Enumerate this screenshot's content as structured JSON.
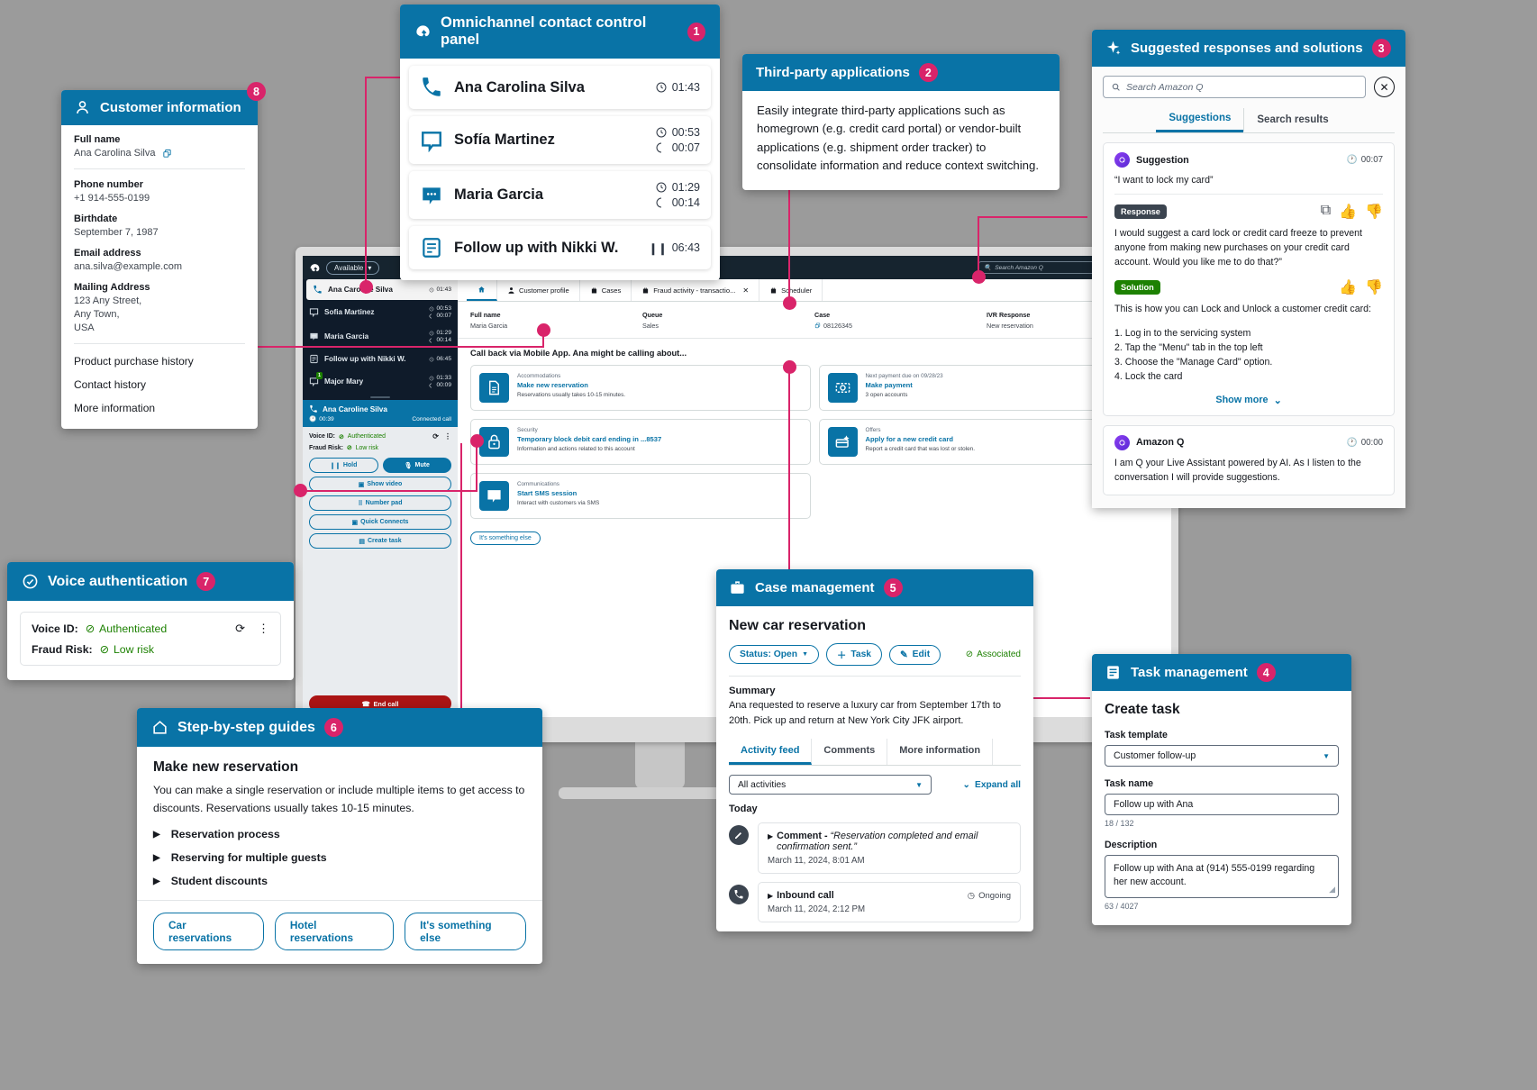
{
  "omnichannel": {
    "title": "Omnichannel contact control panel",
    "num": "1",
    "contacts": [
      {
        "name": "Ana Carolina Silva",
        "icon": "phone-icon",
        "t1": "01:43",
        "t2": ""
      },
      {
        "name": "Sofía Martinez",
        "icon": "chat-icon",
        "t1": "00:53",
        "t2": "00:07"
      },
      {
        "name": "Maria Garcia",
        "icon": "sms-icon",
        "t1": "01:29",
        "t2": "00:14"
      },
      {
        "name": "Follow up with Nikki W.",
        "icon": "task-icon",
        "t1": "06:43",
        "t2": ""
      }
    ]
  },
  "thirdparty": {
    "title": "Third-party applications",
    "num": "2",
    "body": "Easily integrate third-party applications such as homegrown (e.g. credit card portal) or vendor-built applications (e.g. shipment order tracker) to consolidate information and reduce context switching."
  },
  "suggestions": {
    "title": "Suggested responses and solutions",
    "num": "3",
    "search_placeholder": "Search Amazon Q",
    "tabs": [
      "Suggestions",
      "Search results"
    ],
    "active_tab": "Suggestions",
    "card": {
      "label": "Suggestion",
      "time": "00:07",
      "quote": "“I want to lock my card”",
      "response_chip": "Response",
      "response_text": "I would suggest a card lock or credit card freeze to prevent anyone from making new purchases on your credit card account. Would you like me to do that?”",
      "solution_chip": "Solution",
      "solution_text": "This is how you can Lock and Unlock a customer credit card:",
      "steps": [
        "1. Log in to the servicing system",
        "2. Tap the \"Menu\" tab in the top left",
        "3. Choose the \"Manage Card\" option.",
        "4. Lock the card"
      ],
      "show_more": "Show more"
    },
    "amazonq": {
      "label": "Amazon Q",
      "time": "00:00",
      "text": "I am Q your Live Assistant powered by AI. As I listen to the conversation I will provide suggestions."
    }
  },
  "task": {
    "title": "Task management",
    "num": "4",
    "heading": "Create task",
    "template_label": "Task template",
    "template_value": "Customer follow-up",
    "name_label": "Task name",
    "name_value": "Follow up with Ana",
    "name_count": "18 / 132",
    "desc_label": "Description",
    "desc_value": "Follow up with Ana at (914) 555-0199 regarding her new account.",
    "desc_count": "63 / 4027"
  },
  "case": {
    "title": "Case management",
    "num": "5",
    "heading": "New car reservation",
    "status_button": "Status: Open",
    "task_button": "Task",
    "edit_button": "Edit",
    "associated": "Associated",
    "summary_label": "Summary",
    "summary": "Ana requested to reserve a luxury car from September 17th to 20th. Pick up and return at New York City JFK airport.",
    "tabs": [
      "Activity feed",
      "Comments",
      "More information"
    ],
    "active_tab": "Activity feed",
    "filter": "All activities",
    "expand": "Expand all",
    "today": "Today",
    "activities": [
      {
        "icon": "pencil-icon",
        "title_bold": "Comment - ",
        "title_italic": "“Reservation completed and email confirmation sent.”",
        "date": "March 11, 2024, 8:01 AM",
        "status": ""
      },
      {
        "icon": "phone-icon",
        "title_bold": "Inbound call",
        "title_italic": "",
        "date": "March 11, 2024, 2:12 PM",
        "status": "Ongoing"
      }
    ]
  },
  "guides": {
    "title": "Step-by-step guides",
    "num": "6",
    "heading": "Make new reservation",
    "body": "You can make a single reservation or include multiple items to get access to discounts. Reservations usually takes 10-15 minutes.",
    "items": [
      "Reservation process",
      "Reserving for multiple guests",
      "Student discounts"
    ],
    "pills": [
      "Car reservations",
      "Hotel reservations",
      "It's something else"
    ]
  },
  "voice": {
    "title": "Voice authentication",
    "num": "7",
    "rows": [
      {
        "k": "Voice ID:",
        "v": "Authenticated"
      },
      {
        "k": "Fraud Risk:",
        "v": "Low risk"
      }
    ]
  },
  "customer": {
    "title": "Customer information",
    "num": "8",
    "fields": [
      {
        "k": "Full name",
        "v": "Ana Carolina Silva",
        "copy": true
      },
      {
        "k": "Phone number",
        "v": "+1 914-555-0199",
        "copy": false
      },
      {
        "k": "Birthdate",
        "v": "September 7, 1987",
        "copy": false
      },
      {
        "k": "Email address",
        "v": "ana.silva@example.com",
        "copy": false
      }
    ],
    "mailing_label": "Mailing Address",
    "mailing": [
      "123 Any Street,",
      "Any Town,",
      "USA"
    ],
    "links": [
      "Product purchase history",
      "Contact history",
      "More information"
    ]
  },
  "desktop": {
    "ccp": {
      "status": "Available",
      "contacts": [
        {
          "name": "Ana Caroline Silva",
          "t1": "01:43",
          "t2": "",
          "icon": "phone-icon",
          "active": true,
          "badge": ""
        },
        {
          "name": "Sofia Martinez",
          "t1": "00:53",
          "t2": "00:07",
          "icon": "chat-icon",
          "active": false,
          "badge": ""
        },
        {
          "name": "Maria Garcia",
          "t1": "01:29",
          "t2": "00:14",
          "icon": "sms-icon",
          "active": false,
          "badge": ""
        },
        {
          "name": "Follow up with Nikki W.",
          "t1": "06:45",
          "t2": "",
          "icon": "task-icon",
          "active": false,
          "badge": ""
        },
        {
          "name": "Major Mary",
          "t1": "01:33",
          "t2": "00:09",
          "icon": "chat-icon",
          "active": false,
          "badge": "1"
        }
      ],
      "call_name": "Ana Caroline Silva",
      "call_timer": "00:39",
      "call_state": "Connected call",
      "voice_id_label": "Voice ID:",
      "voice_id_value": "Authenticated",
      "fraud_label": "Fraud Risk:",
      "fraud_value": "Low risk",
      "buttons": [
        "Hold",
        "Mute",
        "Show video",
        "Number pad",
        "Quick Connects",
        "Create task"
      ],
      "end_call": "End call",
      "else_pill": "It's something else"
    },
    "work": {
      "search_placeholder": "Search Amazon Q",
      "tabs": [
        "Customer profile",
        "Cases",
        "Fraud activity - transactio...",
        "Scheduler"
      ],
      "fields": [
        {
          "k": "Full name",
          "v": "Maria Garcia",
          "copy": false
        },
        {
          "k": "Queue",
          "v": "Sales",
          "copy": false
        },
        {
          "k": "Case",
          "v": "08126345",
          "copy": true
        },
        {
          "k": "IVR Response",
          "v": "New reservation",
          "copy": false
        }
      ],
      "heading": "Call back via Mobile App. Ana might be calling about...",
      "cards": [
        {
          "cat": "Accommodations",
          "title": "Make new reservation",
          "sub": "Reservations usually takes 10-15 minutes.",
          "icon": "document-icon"
        },
        {
          "cat": "Next payment due on 09/28/23",
          "title": "Make payment",
          "sub": "3 open accounts",
          "icon": "money-icon"
        },
        {
          "cat": "Security",
          "title": "Temporary block debit card ending in ...8537",
          "sub": "Information and actions related to this account",
          "icon": "lock-icon"
        },
        {
          "cat": "Offers",
          "title": "Apply for a new credit card",
          "sub": "Report a credit card that was lost or stolen.",
          "icon": "card-icon"
        },
        {
          "cat": "Communications",
          "title": "Start SMS session",
          "sub": "Interact with customers via SMS",
          "icon": "sms-icon"
        }
      ]
    }
  },
  "colors": {
    "accent": "#0973a6",
    "pink": "#d9246a",
    "green": "#1d8102",
    "red": "#ab1414"
  }
}
